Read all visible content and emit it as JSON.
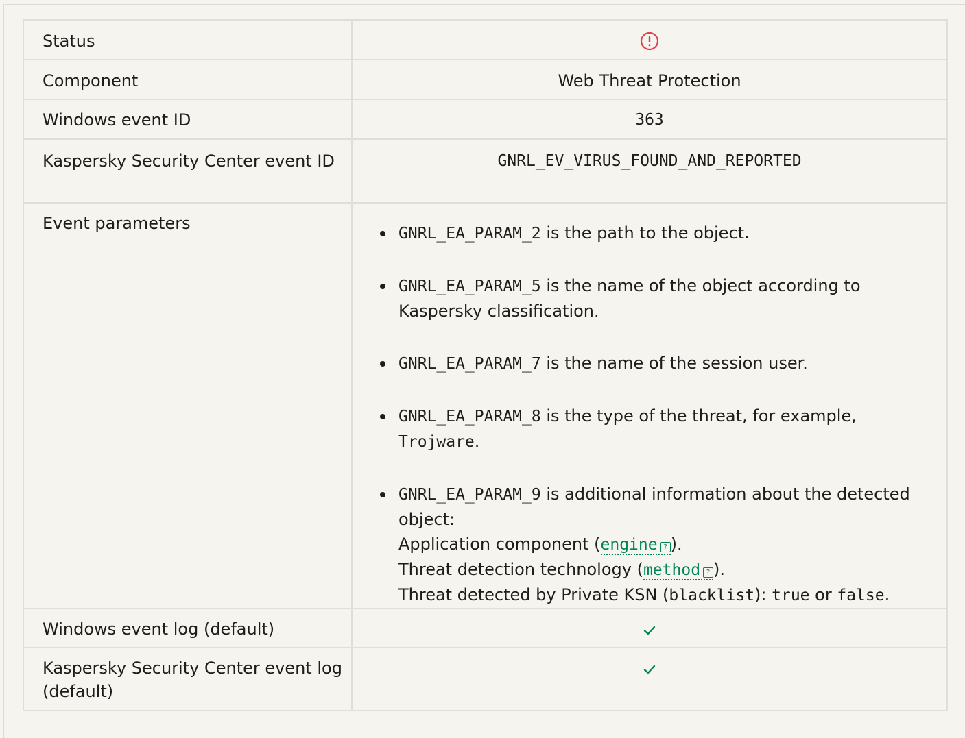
{
  "rows": {
    "status": {
      "label": "Status",
      "icon": "warning-circle-icon",
      "icon_color": "#e0404a"
    },
    "component": {
      "label": "Component",
      "value": "Web Threat Protection"
    },
    "windows_event_id": {
      "label": "Windows event ID",
      "value": "363"
    },
    "ksc_event_id": {
      "label": "Kaspersky Security Center event ID",
      "value": "GNRL_EV_VIRUS_FOUND_AND_REPORTED"
    },
    "event_parameters": {
      "label": "Event parameters",
      "items": [
        {
          "param": "GNRL_EA_PARAM_2",
          "text": " is the path to the object."
        },
        {
          "param": "GNRL_EA_PARAM_5",
          "text": " is the name of the object according to Kaspersky classification."
        },
        {
          "param": "GNRL_EA_PARAM_7",
          "text": " is the name of the session user."
        },
        {
          "param": "GNRL_EA_PARAM_8",
          "text": " is the type of the threat, for example,",
          "example": "Trojware",
          "example_suffix": "."
        },
        {
          "param": "GNRL_EA_PARAM_9",
          "text": " is additional information about the detected object:",
          "line1_prefix": "Application component (",
          "line1_link": "engine",
          "line1_suffix": ").",
          "line2_prefix": "Threat detection technology (",
          "line2_link": "method",
          "line2_suffix": ").",
          "line3_prefix": "Threat detected by Private KSN (",
          "line3_code": "blacklist",
          "line3_mid": "): ",
          "line3_true": "true",
          "line3_or": " or ",
          "line3_false": "false",
          "line3_end": "."
        }
      ]
    },
    "windows_event_log": {
      "label": "Windows event log (default)",
      "icon": "checkmark-icon"
    },
    "ksc_event_log": {
      "label": "Kaspersky Security Center event log (default)",
      "icon": "checkmark-icon"
    }
  },
  "colors": {
    "accent": "#00845a",
    "warning": "#e0404a",
    "border": "#dedfdb",
    "background": "#f5f4ef"
  }
}
